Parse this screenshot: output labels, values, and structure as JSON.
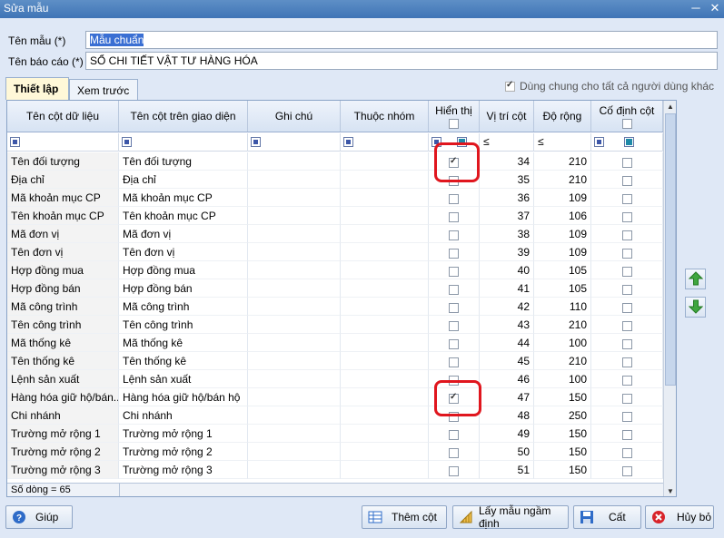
{
  "window": {
    "title": "Sửa mẫu"
  },
  "form": {
    "template_name_label": "Tên mẫu (*)",
    "template_name_value": "Mẫu chuẩn",
    "report_name_label": "Tên báo cáo (*)",
    "report_name_value": "SỔ CHI TIẾT VẬT TƯ HÀNG HÓA"
  },
  "tabs": [
    "Thiết lập",
    "Xem trước"
  ],
  "share_label": "Dùng chung cho tất cả người dùng khác",
  "columns": {
    "data_col": "Tên cột dữ liệu",
    "ui_col": "Tên cột trên giao diện",
    "note": "Ghi chú",
    "group": "Thuộc nhóm",
    "show": "Hiển thị",
    "position": "Vị trí cột",
    "width": "Độ rộng",
    "fixed": "Cố định cột"
  },
  "filter": {
    "position_op": "≤",
    "width_op": "≤"
  },
  "rows": [
    {
      "data": "Tên đối tượng",
      "ui": "Tên đối tượng",
      "show": true,
      "pos": "34",
      "width": "210"
    },
    {
      "data": "Địa chỉ",
      "ui": "Địa chỉ",
      "show": false,
      "pos": "35",
      "width": "210"
    },
    {
      "data": "Mã khoản mục CP",
      "ui": "Mã khoản mục CP",
      "show": false,
      "pos": "36",
      "width": "109"
    },
    {
      "data": "Tên khoản mục CP",
      "ui": "Tên khoản mục CP",
      "show": false,
      "pos": "37",
      "width": "106"
    },
    {
      "data": "Mã đơn vị",
      "ui": "Mã đơn vị",
      "show": false,
      "pos": "38",
      "width": "109"
    },
    {
      "data": "Tên đơn vị",
      "ui": "Tên đơn vị",
      "show": false,
      "pos": "39",
      "width": "109"
    },
    {
      "data": "Hợp đồng mua",
      "ui": "Hợp đồng mua",
      "show": false,
      "pos": "40",
      "width": "105"
    },
    {
      "data": "Hợp đồng bán",
      "ui": "Hợp đồng bán",
      "show": false,
      "pos": "41",
      "width": "105"
    },
    {
      "data": "Mã công trình",
      "ui": "Mã công trình",
      "show": false,
      "pos": "42",
      "width": "110"
    },
    {
      "data": "Tên công trình",
      "ui": "Tên công trình",
      "show": false,
      "pos": "43",
      "width": "210"
    },
    {
      "data": "Mã thống kê",
      "ui": "Mã thống kê",
      "show": false,
      "pos": "44",
      "width": "100"
    },
    {
      "data": "Tên thống kê",
      "ui": "Tên thống kê",
      "show": false,
      "pos": "45",
      "width": "210"
    },
    {
      "data": "Lệnh sản xuất",
      "ui": "Lệnh sản xuất",
      "show": false,
      "pos": "46",
      "width": "100"
    },
    {
      "data": "Hàng hóa giữ hộ/bán...",
      "ui": "Hàng hóa giữ hộ/bán hộ",
      "show": true,
      "pos": "47",
      "width": "150"
    },
    {
      "data": "Chi nhánh",
      "ui": "Chi nhánh",
      "show": false,
      "pos": "48",
      "width": "250"
    },
    {
      "data": "Trường mở rộng 1",
      "ui": "Trường mở rộng 1",
      "show": false,
      "pos": "49",
      "width": "150"
    },
    {
      "data": "Trường mở rộng 2",
      "ui": "Trường mở rộng 2",
      "show": false,
      "pos": "50",
      "width": "150"
    },
    {
      "data": "Trường mở rộng 3",
      "ui": "Trường mở rộng 3",
      "show": false,
      "pos": "51",
      "width": "150"
    }
  ],
  "footer": {
    "row_count": "Số dòng = 65"
  },
  "buttons": {
    "help": "Giúp",
    "add_column": "Thêm cột",
    "load_default": "Lấy mẫu ngầm định",
    "save": "Cất",
    "cancel": "Hủy bỏ"
  },
  "colors": {
    "accent": "#3f74b6",
    "highlight": "#e0161e",
    "tab_active": "#fff8d8"
  }
}
